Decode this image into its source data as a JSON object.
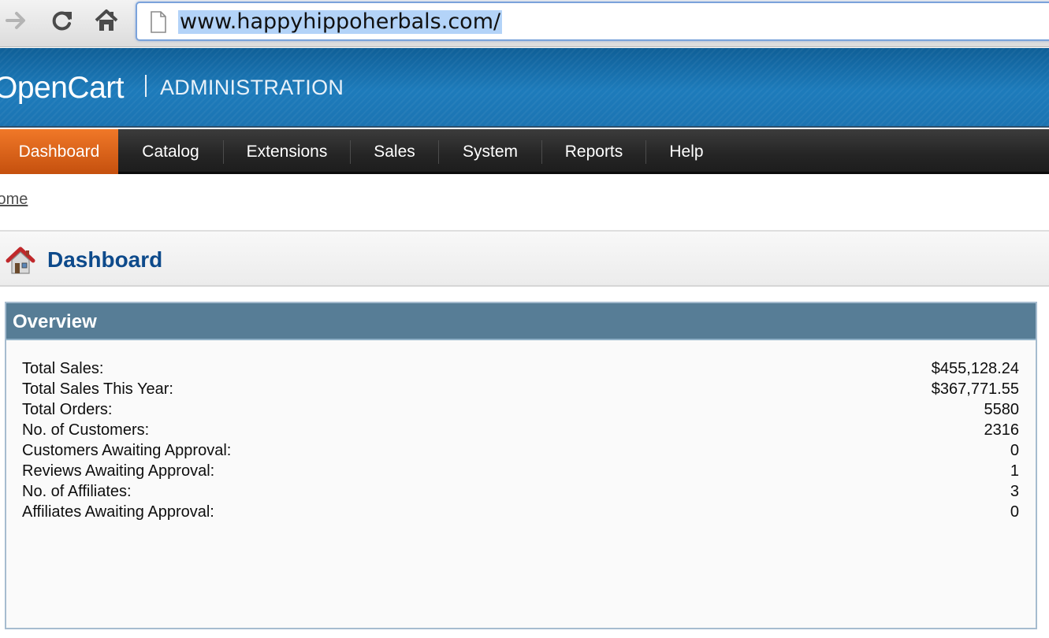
{
  "browser": {
    "url": "www.happyhippoherbals.com/",
    "icons": [
      "forward-arrow-icon",
      "reload-icon",
      "home-icon",
      "page-icon"
    ]
  },
  "header": {
    "logo": "OpenCart",
    "subtitle": "ADMINISTRATION"
  },
  "menu": {
    "items": [
      {
        "label": "Dashboard",
        "active": true
      },
      {
        "label": "Catalog"
      },
      {
        "label": "Extensions"
      },
      {
        "label": "Sales"
      },
      {
        "label": "System"
      },
      {
        "label": "Reports"
      },
      {
        "label": "Help"
      }
    ]
  },
  "breadcrumb": {
    "home": "Home"
  },
  "page": {
    "title": "Dashboard",
    "icon": "house-icon"
  },
  "overview": {
    "title": "Overview",
    "stats": [
      {
        "label": "Total Sales:",
        "value": "$455,128.24"
      },
      {
        "label": "Total Sales This Year:",
        "value": "$367,771.55"
      },
      {
        "label": "Total Orders:",
        "value": "5580"
      },
      {
        "label": "No. of Customers:",
        "value": "2316"
      },
      {
        "label": "Customers Awaiting Approval:",
        "value": "0"
      },
      {
        "label": "Reviews Awaiting Approval:",
        "value": "1"
      },
      {
        "label": "No. of Affiliates:",
        "value": "3"
      },
      {
        "label": "Affiliates Awaiting Approval:",
        "value": "0"
      }
    ]
  },
  "colors": {
    "header_blue": "#1d7bbb",
    "menu_active_orange": "#e06a1e",
    "title_blue": "#0d4a8b",
    "panel_head": "#577d96"
  }
}
